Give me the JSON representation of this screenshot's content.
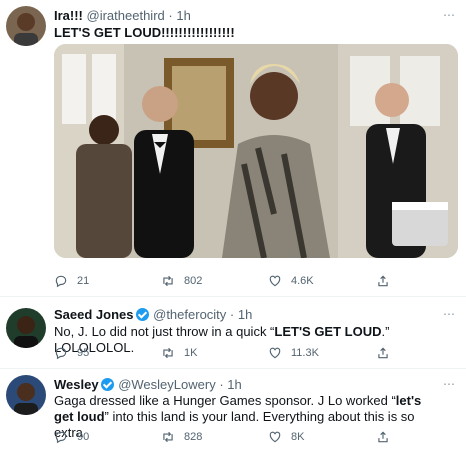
{
  "tweets": [
    {
      "name": "Ira!!!",
      "handle": "@iratheethird",
      "dot": "·",
      "time": "1h",
      "text": "LET'S GET LOUD!!!!!!!!!!!!!!!!!",
      "more": "⋯",
      "counts": {
        "reply": "21",
        "retweet": "802",
        "like": "4.6K"
      }
    },
    {
      "name": "Saeed Jones",
      "handle": "@theferocity",
      "dot": "·",
      "time": "1h",
      "text_parts": [
        "No, J. Lo did not just throw in a quick “",
        "LET'S GET LOUD",
        ".” LOLOLOLOL."
      ],
      "more": "⋯",
      "counts": {
        "reply": "95",
        "retweet": "1K",
        "like": "11.3K"
      }
    },
    {
      "name": "Wesley",
      "handle": "@WesleyLowery",
      "dot": "·",
      "time": "1h",
      "text_parts": [
        "Gaga dressed like a Hunger Games sponsor. J Lo worked “",
        "let's get loud",
        "” into this land is your land. Everything about this is so extra"
      ],
      "more": "⋯",
      "counts": {
        "reply": "90",
        "retweet": "828",
        "like": "8K"
      }
    }
  ],
  "colors": {
    "accent": "#1d9bf0",
    "secondary_text": "#536471",
    "divider": "#eff3f4"
  },
  "icons": [
    "reply-icon",
    "retweet-icon",
    "like-icon",
    "share-icon",
    "verified-badge-icon"
  ]
}
